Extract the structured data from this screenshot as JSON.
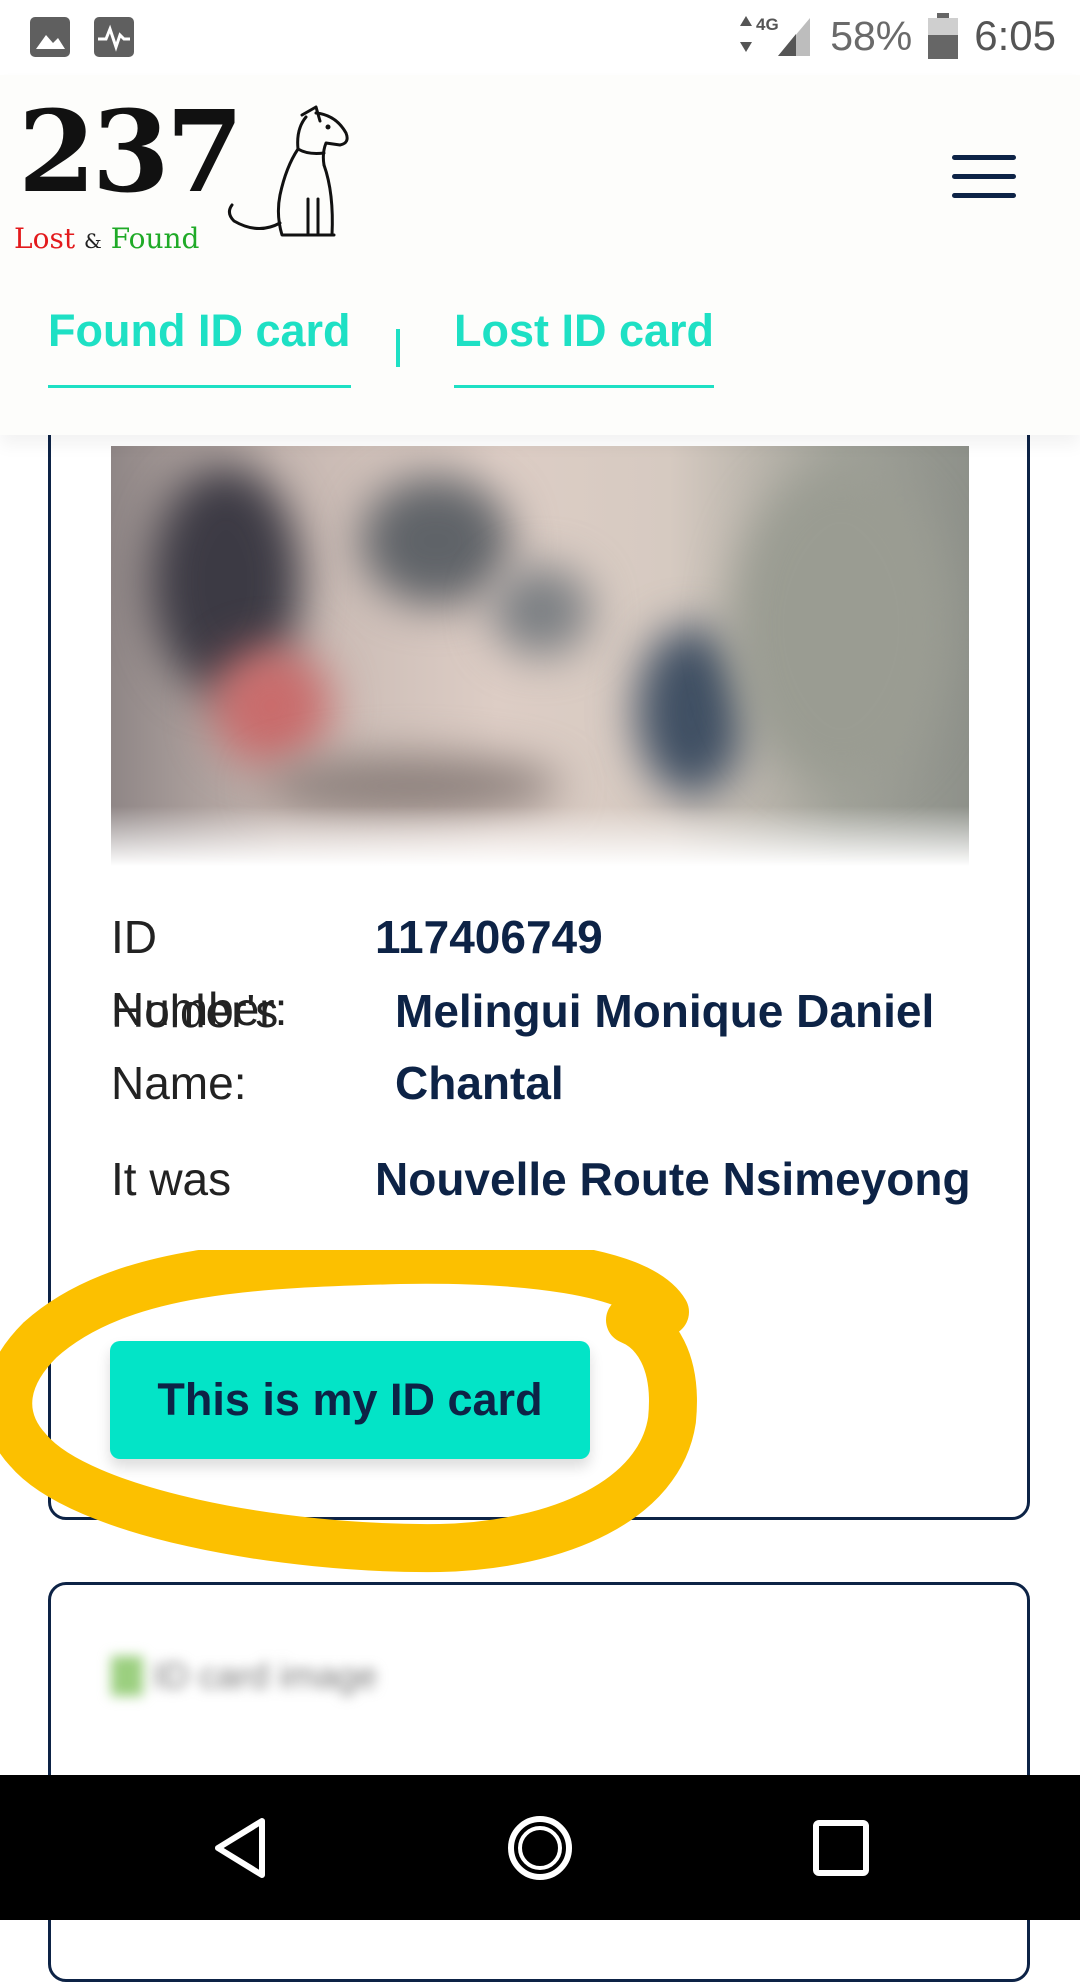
{
  "status_bar": {
    "left_icons": [
      "image-icon",
      "activity-icon"
    ],
    "network": "4G",
    "battery": "58%",
    "time": "6:05"
  },
  "header": {
    "logo": {
      "number": "237",
      "word_lost": "Lost",
      "word_and": "&",
      "word_found": "Found"
    },
    "menu_icon": "hamburger-menu-icon",
    "tabs": [
      {
        "label": "Found ID card"
      },
      {
        "label": "Lost ID card"
      }
    ]
  },
  "card": {
    "id_number_label": "ID Number:",
    "id_number_value": "117406749",
    "holder_label_1": "Holder's",
    "holder_label_2": "Name:",
    "holder_value_1": "Melingui Monique Daniel",
    "holder_value_2": "Chantal",
    "place_label": "It was",
    "place_value": "Nouvelle Route Nsimeyong",
    "claim_button": "This is my ID card"
  },
  "next_card": {
    "image_alt": "ID card image"
  },
  "colors": {
    "accent": "#03e4c7",
    "navy": "#0d2346",
    "highlight": "#fcc000"
  },
  "nav_bar": [
    "back-icon",
    "home-icon",
    "recents-icon"
  ]
}
